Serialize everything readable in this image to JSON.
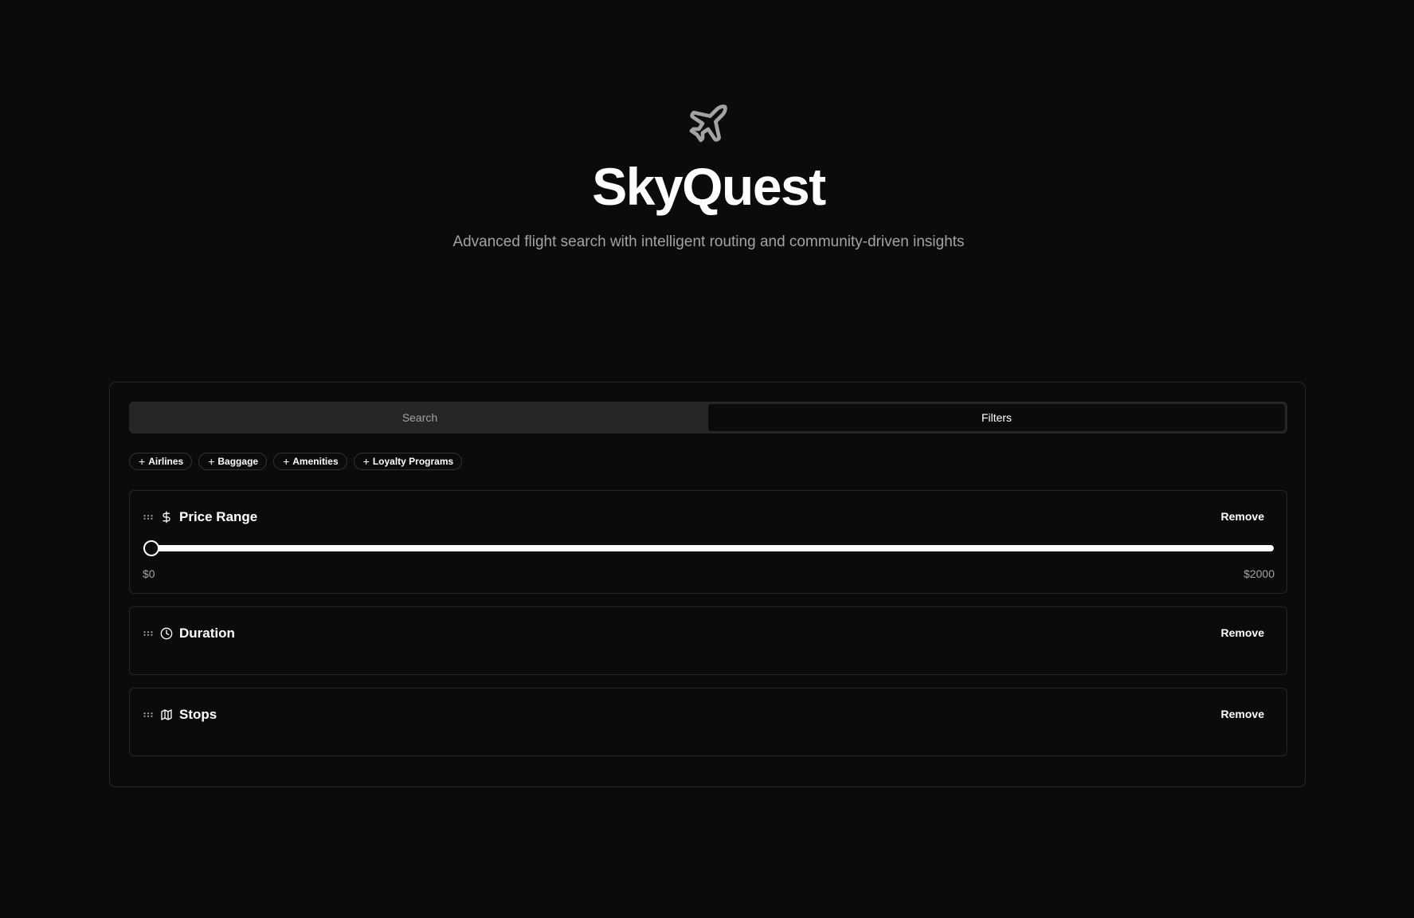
{
  "header": {
    "logo_icon": "plane-icon",
    "title": "SkyQuest",
    "subtitle": "Advanced flight search with intelligent routing and community-driven insights"
  },
  "tabs": [
    {
      "label": "Search",
      "active": false
    },
    {
      "label": "Filters",
      "active": true
    }
  ],
  "add_filter_chips": [
    {
      "icon": "plus-icon",
      "label": "Airlines"
    },
    {
      "icon": "plus-icon",
      "label": "Baggage"
    },
    {
      "icon": "plus-icon",
      "label": "Amenities"
    },
    {
      "icon": "plus-icon",
      "label": "Loyalty Programs"
    }
  ],
  "filters": [
    {
      "title": "Price Range",
      "icon": "dollar-icon",
      "remove_label": "Remove",
      "slider": {
        "min": 0,
        "max": 2000,
        "value": 0,
        "min_label": "$0",
        "max_label": "$2000"
      }
    },
    {
      "title": "Duration",
      "icon": "clock-icon",
      "remove_label": "Remove"
    },
    {
      "title": "Stops",
      "icon": "map-icon",
      "remove_label": "Remove"
    }
  ],
  "colors": {
    "background": "#0b0b0b",
    "border": "#262626",
    "muted_text": "#a3a3a3",
    "tab_track": "#262626"
  }
}
